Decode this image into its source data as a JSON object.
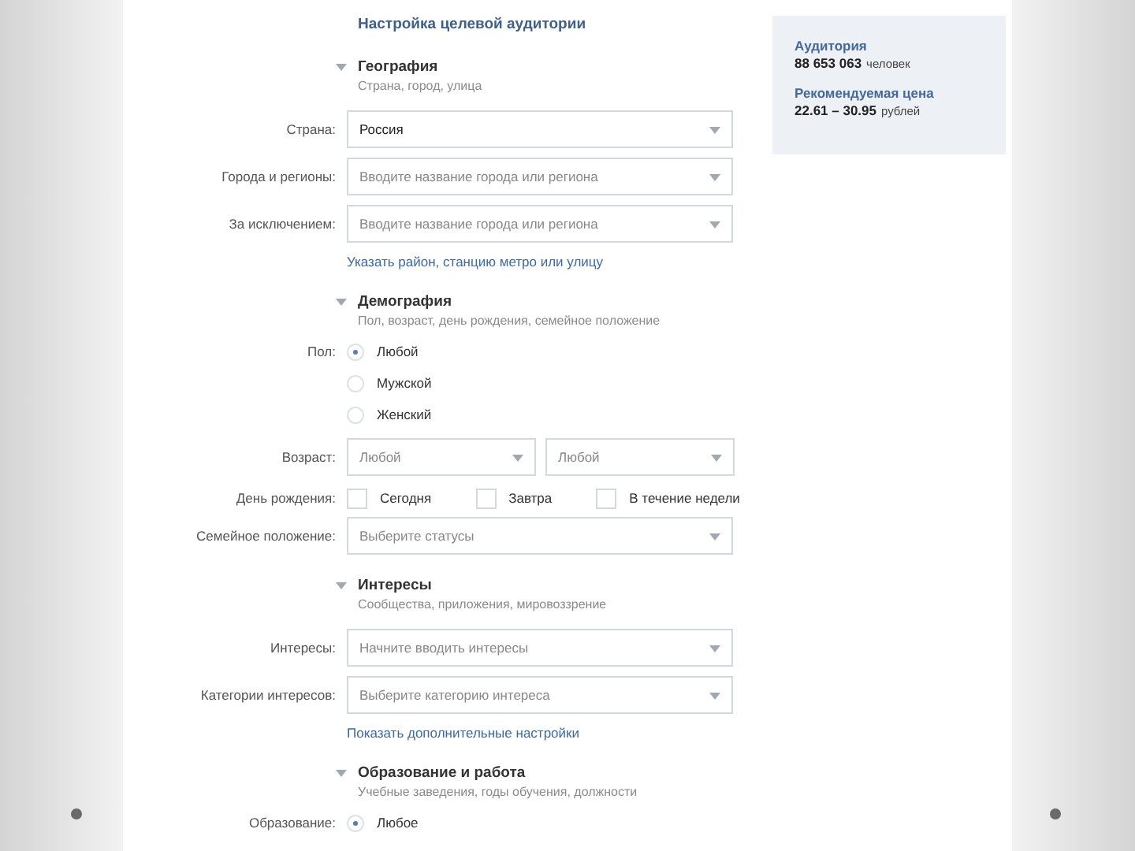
{
  "title": "Настройка целевой аудитории",
  "sections": [
    {
      "heading": "География",
      "subtitle": "Страна, город, улица",
      "expanded": true,
      "rows": [
        {
          "kind": "select",
          "label": "Страна:",
          "value": "Россия"
        },
        {
          "kind": "select",
          "label": "Города и регионы:",
          "placeholder": "Вводите название города или региона"
        },
        {
          "kind": "select",
          "label": "За исключением:",
          "placeholder": "Вводите название города или региона"
        },
        {
          "kind": "link",
          "text": "Указать район, станцию метро или улицу"
        }
      ]
    },
    {
      "heading": "Демография",
      "subtitle": "Пол, возраст, день рождения, семейное положение",
      "expanded": true,
      "rows": [
        {
          "kind": "radio",
          "label": "Пол:",
          "options": [
            {
              "label": "Любой",
              "selected": true
            },
            {
              "label": "Мужской",
              "selected": false
            },
            {
              "label": "Женский",
              "selected": false
            }
          ]
        },
        {
          "kind": "pair",
          "label": "Возраст:",
          "fields": [
            {
              "placeholder": "Любой"
            },
            {
              "placeholder": "Любой"
            }
          ]
        },
        {
          "kind": "checks",
          "label": "День рождения:",
          "options": [
            {
              "label": "Сегодня",
              "checked": false
            },
            {
              "label": "Завтра",
              "checked": false
            },
            {
              "label": "В течение недели",
              "checked": false
            }
          ]
        },
        {
          "kind": "select",
          "label": "Семейное положение:",
          "placeholder": "Выберите статусы"
        }
      ]
    },
    {
      "heading": "Интересы",
      "subtitle": "Сообщества, приложения, мировоззрение",
      "expanded": true,
      "rows": [
        {
          "kind": "select",
          "label": "Интересы:",
          "placeholder": "Начните вводить интересы"
        },
        {
          "kind": "select",
          "label": "Категории интересов:",
          "placeholder": "Выберите категорию интереса"
        },
        {
          "kind": "link",
          "text": "Показать дополнительные настройки"
        }
      ]
    },
    {
      "heading": "Образование и работа",
      "subtitle": "Учебные заведения, годы обучения, должности",
      "expanded": true,
      "rows": [
        {
          "kind": "radio",
          "label": "Образование:",
          "options": [
            {
              "label": "Любое",
              "selected": true
            }
          ]
        }
      ]
    }
  ],
  "summary": [
    {
      "heading": "Аудитория",
      "value": "88 653 063",
      "unit": "человек"
    },
    {
      "heading": "Рекомендуемая цена",
      "value": "22.61 – 30.95",
      "unit": "рублей"
    }
  ]
}
